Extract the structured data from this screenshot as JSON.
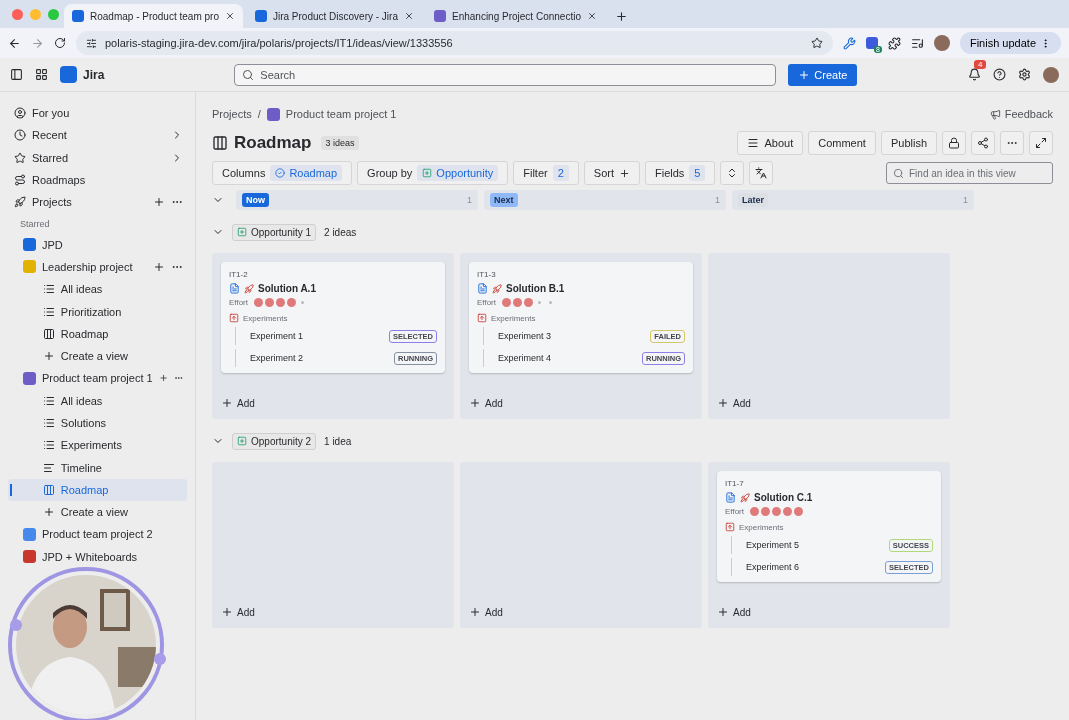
{
  "browser": {
    "tabs": [
      {
        "title": "Roadmap - Product team pro",
        "selected": true
      },
      {
        "title": "Jira Product Discovery - Jira",
        "selected": false
      },
      {
        "title": "Enhancing Project Connectio",
        "selected": false
      }
    ],
    "url": "polaris-staging.jira-dev.com/jira/polaris/projects/IT1/ideas/view/1333556",
    "extension_badge": "8",
    "update_button": "Finish update"
  },
  "app": {
    "product": "Jira",
    "search": {
      "placeholder": "Search"
    },
    "create": "Create",
    "notifications": "4"
  },
  "sidebar": {
    "items": [
      {
        "kind": "person",
        "label": "For you",
        "selected": false
      },
      {
        "kind": "clock",
        "label": "Recent",
        "selected": false,
        "chevron": true
      },
      {
        "kind": "star",
        "label": "Starred",
        "selected": false,
        "chevron": true
      },
      {
        "kind": "roadmaps",
        "label": "Roadmaps",
        "selected": false
      },
      {
        "kind": "rocket",
        "label": "Projects",
        "selected": false,
        "actions": true
      }
    ],
    "section": "Starred",
    "projects": [
      {
        "label": "JPD",
        "color": "#1868db",
        "selected": false
      },
      {
        "label": "Leadership project",
        "color": "#e2b203",
        "selected": false,
        "actions": true,
        "children": [
          {
            "kind": "list",
            "label": "All ideas",
            "selected": false
          },
          {
            "kind": "list",
            "label": "Prioritization",
            "selected": false
          },
          {
            "kind": "board",
            "label": "Roadmap",
            "selected": false
          },
          {
            "kind": "create",
            "label": "Create a view",
            "selected": false
          }
        ]
      },
      {
        "label": "Product team project 1",
        "color": "#6e5dc6",
        "selected": false,
        "actions": true,
        "children": [
          {
            "kind": "list",
            "label": "All ideas",
            "selected": false
          },
          {
            "kind": "list",
            "label": "Solutions",
            "selected": false
          },
          {
            "kind": "list",
            "label": "Experiments",
            "selected": false
          },
          {
            "kind": "timeline",
            "label": "Timeline",
            "selected": false
          },
          {
            "kind": "board",
            "label": "Roadmap",
            "selected": true
          },
          {
            "kind": "create",
            "label": "Create a view",
            "selected": false
          }
        ]
      },
      {
        "label": "Product team project 2",
        "color": "#4688ec",
        "selected": false
      },
      {
        "label": "JPD + Whiteboards",
        "color": "#c9372c",
        "selected": false
      }
    ]
  },
  "main": {
    "breadcrumbs": [
      "Projects",
      "Product team project 1"
    ],
    "separator": "/",
    "feedback": "Feedback",
    "title": "Roadmap",
    "count": "3 ideas",
    "actions": [
      "About",
      "Comment",
      "Publish"
    ],
    "toolbar": {
      "columns_label": "Columns",
      "columns_value": "Roadmap",
      "group_label": "Group by",
      "group_value": "Opportunity",
      "filter_label": "Filter",
      "filter_count": "2",
      "sort_label": "Sort",
      "fields_label": "Fields",
      "fields_count": "5",
      "find_placeholder": "Find an idea in this view"
    },
    "columns": [
      {
        "label": "Now",
        "count": "1",
        "color": "#1868db"
      },
      {
        "label": "Next",
        "count": "1",
        "color": "#8fb8f6"
      },
      {
        "label": "Later",
        "count": "1",
        "color": "#dcdfe4"
      }
    ],
    "groups": [
      {
        "label": "Opportunity 1",
        "count": "2 ideas",
        "expanded": true,
        "cells": [
          {
            "add": "Add",
            "cards": [
              {
                "id": "IT1-2",
                "title": "Solution A.1",
                "effort_label": "Effort",
                "stars": 4,
                "experiments_label": "Experiments",
                "experiments": [
                  {
                    "name": "Experiment 1",
                    "status": "SELECTED",
                    "color": "#8f7ee7"
                  },
                  {
                    "name": "Experiment 2",
                    "status": "RUNNING",
                    "color": "#8590a2"
                  }
                ]
              }
            ]
          },
          {
            "add": "Add",
            "cards": [
              {
                "id": "IT1-3",
                "title": "Solution B.1",
                "effort_label": "Effort",
                "stars": 3,
                "experiments_label": "Experiments",
                "experiments": [
                  {
                    "name": "Experiment 3",
                    "status": "FAILED",
                    "color": "#d3c76a"
                  },
                  {
                    "name": "Experiment 4",
                    "status": "RUNNING",
                    "color": "#8f7ee7"
                  }
                ]
              }
            ]
          },
          {
            "add": "Add"
          }
        ]
      },
      {
        "label": "Opportunity 2",
        "count": "1 idea",
        "expanded": true,
        "cells": [
          {
            "add": "Add"
          },
          {
            "add": "Add"
          },
          {
            "add": "Add",
            "cards": [
              {
                "id": "IT1-7",
                "title": "Solution C.1",
                "effort_label": "Effort",
                "stars": 5,
                "experiments_label": "Experiments",
                "experiments": [
                  {
                    "name": "Experiment 5",
                    "status": "SUCCESS",
                    "color": "#b3d87a"
                  },
                  {
                    "name": "Experiment 6",
                    "status": "SELECTED",
                    "color": "#7a9fd8"
                  }
                ]
              }
            ]
          }
        ]
      }
    ]
  }
}
